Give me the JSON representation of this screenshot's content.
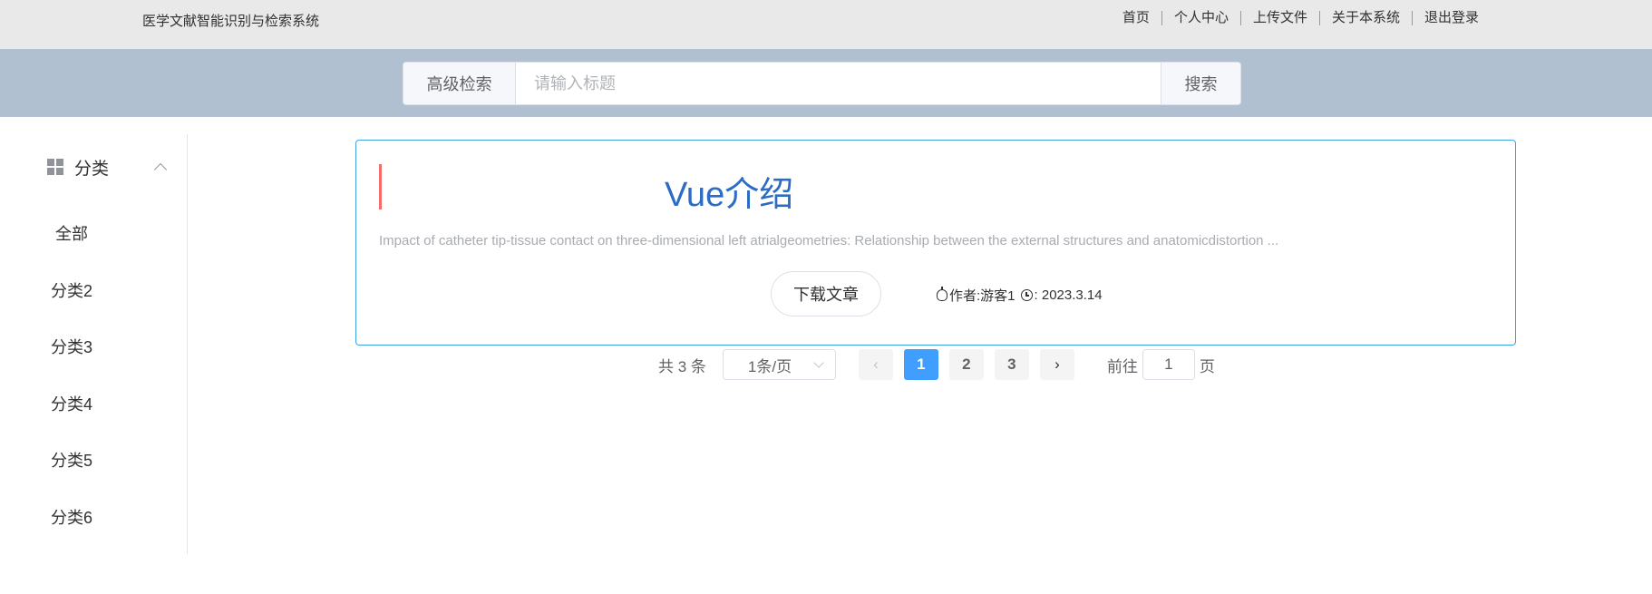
{
  "header": {
    "brand": "医学文献智能识别与检索系统",
    "nav": [
      "首页",
      "个人中心",
      "上传文件",
      "关于本系统",
      "退出登录"
    ]
  },
  "search": {
    "advanced_label": "高级检索",
    "placeholder": "请输入标题",
    "value": "",
    "button_label": "搜索"
  },
  "sidebar": {
    "header_label": "分类",
    "header_icon": "grid-icon",
    "items": [
      "全部",
      "分类2",
      "分类3",
      "分类4",
      "分类5",
      "分类6"
    ]
  },
  "article": {
    "title": "Vue介绍",
    "abstract": "Impact of catheter tip-tissue contact on three-dimensional left atrialgeometries: Relationship between the external structures and anatomicdistortion ...",
    "download_label": "下载文章",
    "author_label": "作者:游客1",
    "date_label": ": 2023.3.14"
  },
  "pagination": {
    "total_label": "共 3 条",
    "page_size_label": "1条/页",
    "pages": [
      "1",
      "2",
      "3"
    ],
    "current_page": 1,
    "goto_prefix": "前往",
    "goto_value": "1",
    "goto_suffix": "页"
  },
  "colors": {
    "accent": "#409eff",
    "title": "#2c6cc4",
    "title_bar": "#f56c6c",
    "card_border": "#3ba3e6",
    "search_band": "#b1c0d1",
    "topbar": "#e9e9e9"
  }
}
